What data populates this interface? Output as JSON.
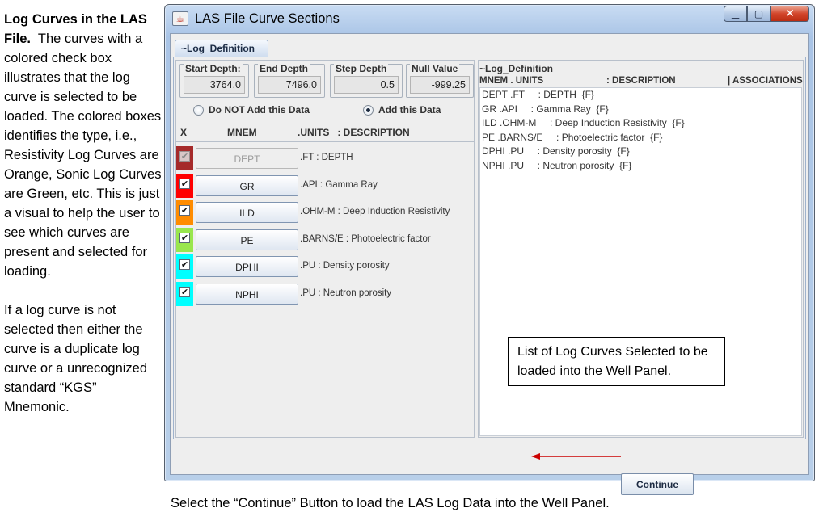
{
  "side_text": {
    "heading": "Log Curves in the LAS File.",
    "para1": "The curves with a colored check box illustrates that the log curve is selected to be loaded.  The colored boxes identifies the type, i.e., Resistivity Log Curves are Orange, Sonic Log Curves are Green, etc.  This is just a visual to help the user to see which curves are present and selected for loading.",
    "para2": "If a log curve is not selected then either the curve is a duplicate log curve or a unrecognized  standard “KGS” Mnemonic."
  },
  "bottom_caption": "Select the “Continue” Button to load the LAS Log Data into the Well Panel.",
  "window": {
    "title": "LAS File Curve Sections",
    "icon": "java-cup-icon",
    "buttons": {
      "minimize": "minimize-icon",
      "maximize": "maximize-icon",
      "close": "close-icon"
    }
  },
  "tab": {
    "label": "~Log_Definition"
  },
  "fields": {
    "start_depth": {
      "label": "Start Depth:",
      "value": "3764.0"
    },
    "end_depth": {
      "label": "End Depth",
      "value": "7496.0"
    },
    "step_depth": {
      "label": "Step Depth",
      "value": "0.5"
    },
    "null_value": {
      "label": "Null Value",
      "value": "-999.25"
    }
  },
  "radios": {
    "do_not_add": {
      "label": "Do NOT Add this Data",
      "selected": false
    },
    "add": {
      "label": "Add this Data",
      "selected": true
    }
  },
  "table_headers": {
    "x": "X",
    "mnem": "MNEM",
    "units_desc": ".UNITS   : DESCRIPTION"
  },
  "curves": [
    {
      "mnem": "DEPT",
      "desc": ".FT : DEPTH",
      "color": "#a52a2a",
      "enabled": false
    },
    {
      "mnem": "GR",
      "desc": ".API : Gamma Ray",
      "color": "#ff0000",
      "enabled": true
    },
    {
      "mnem": "ILD",
      "desc": ".OHM-M : Deep Induction Resistivity",
      "color": "#ff8c00",
      "enabled": true
    },
    {
      "mnem": "PE",
      "desc": ".BARNS/E : Photoelectric factor",
      "color": "#99e64d",
      "enabled": true
    },
    {
      "mnem": "DPHI",
      "desc": ".PU : Density porosity",
      "color": "#00ffff",
      "enabled": true
    },
    {
      "mnem": "NPHI",
      "desc": ".PU : Neutron porosity",
      "color": "#00ffff",
      "enabled": true
    }
  ],
  "right_panel": {
    "title": "~Log_Definition",
    "col_mnem_units": "MNEM . UNITS",
    "col_desc": ": DESCRIPTION",
    "col_assoc": "| ASSOCIATIONS",
    "lines": [
      "DEPT .FT     : DEPTH  {F}",
      "GR .API     : Gamma Ray  {F}",
      "ILD .OHM-M     : Deep Induction Resistivity  {F}",
      "PE .BARNS/E     : Photoelectric factor  {F}",
      "DPHI .PU     : Density porosity  {F}",
      "NPHI .PU     : Neutron porosity  {F}"
    ]
  },
  "callout": "List of Log Curves Selected to be loaded into the Well Panel.",
  "continue_button": "Continue",
  "arrow_color": "#cc0000"
}
